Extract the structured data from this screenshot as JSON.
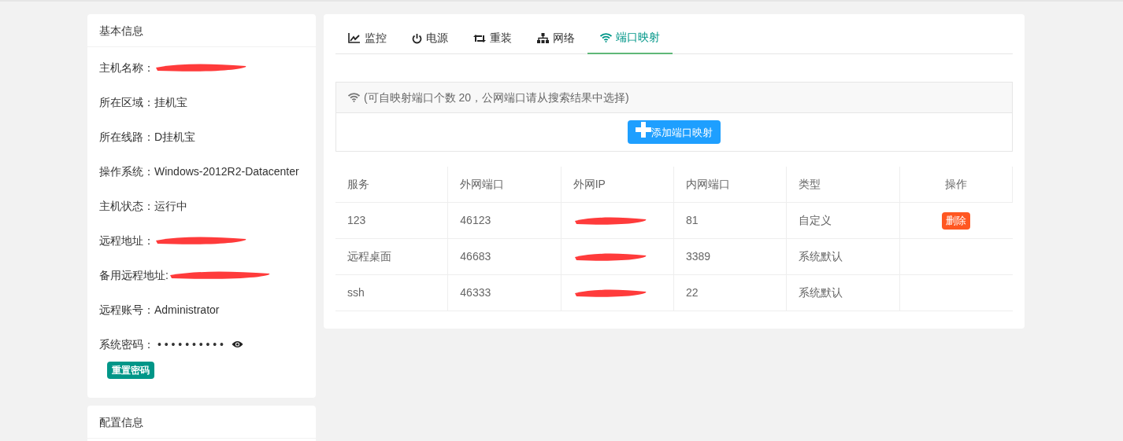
{
  "basic_info": {
    "title": "基本信息",
    "items": [
      {
        "label": "主机名称：",
        "redacted": true
      },
      {
        "label": "所在区域：",
        "value": "挂机宝",
        "redacted": false
      },
      {
        "label": "所在线路：",
        "value": "D挂机宝",
        "redacted": false
      },
      {
        "label": "操作系统：",
        "value": "Windows-2012R2-Datacenter",
        "redacted": false
      },
      {
        "label": "主机状态：",
        "value": "运行中",
        "redacted": false
      },
      {
        "label": "远程地址：",
        "redacted": true
      },
      {
        "label": "备用远程地址:",
        "redacted": true
      },
      {
        "label": "远程账号：",
        "value": "Administrator",
        "redacted": false
      }
    ],
    "password": {
      "label": "系统密码：",
      "value": "• • • • • • • • • •",
      "reset_button": "重置密码"
    }
  },
  "config_info": {
    "title": "配置信息"
  },
  "tabs": [
    {
      "label": "监控",
      "kind": "chart",
      "selected": false
    },
    {
      "label": "电源",
      "kind": "power",
      "selected": false
    },
    {
      "label": "重装",
      "kind": "retweet",
      "selected": false
    },
    {
      "label": "网络",
      "kind": "sitemap",
      "selected": false
    },
    {
      "label": "端口映射",
      "kind": "wifi",
      "selected": true
    }
  ],
  "notice": "(可自映射端口个数 20，公网端口请从搜索结果中选择)",
  "add_button": "添加端口映射",
  "table": {
    "columns": [
      "服务",
      "外网端口",
      "外网IP",
      "内网端口",
      "类型",
      "操作"
    ],
    "rows": [
      {
        "service": "123",
        "public_port": "46123",
        "ip_redacted": true,
        "private_port": "81",
        "type": "自定义",
        "action": "删除"
      },
      {
        "service": "远程桌面",
        "public_port": "46683",
        "ip_redacted": true,
        "private_port": "3389",
        "type": "系统默认"
      },
      {
        "service": "ssh",
        "public_port": "46333",
        "ip_redacted": true,
        "private_port": "22",
        "type": "系统默认"
      }
    ]
  }
}
